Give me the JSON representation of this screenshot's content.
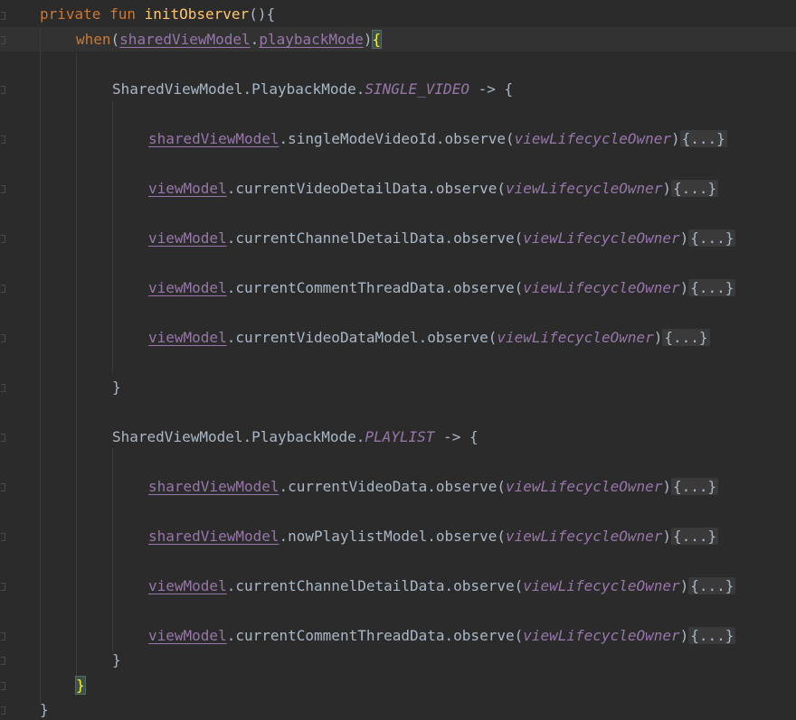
{
  "code": {
    "fun_keywords": "private fun ",
    "fun_name": "initObserver",
    "fun_parens": "(){",
    "when_keyword": "when",
    "paren_open": "(",
    "paren_close": ")",
    "shared_view_model": "sharedViewModel",
    "view_model": "viewModel",
    "dot": ".",
    "playback_mode": "playbackMode",
    "open_brace": "{",
    "close_brace": "}",
    "enum_prefix": "SharedViewModel.PlaybackMode.",
    "arrow": " -> {",
    "mode_single": "SINGLE_VIDEO",
    "mode_playlist": "PLAYLIST",
    "observe_call": ".observe(",
    "owner": "viewLifecycleOwner",
    "folded": "{...}",
    "single_items": [
      {
        "receiver": "sharedViewModel",
        "property": "singleModeVideoId"
      },
      {
        "receiver": "viewModel",
        "property": "currentVideoDetailData"
      },
      {
        "receiver": "viewModel",
        "property": "currentChannelDetailData"
      },
      {
        "receiver": "viewModel",
        "property": "currentCommentThreadData"
      },
      {
        "receiver": "viewModel",
        "property": "currentVideoDataModel"
      }
    ],
    "playlist_items": [
      {
        "receiver": "sharedViewModel",
        "property": "currentVideoData"
      },
      {
        "receiver": "sharedViewModel",
        "property": "nowPlaylistModel"
      },
      {
        "receiver": "viewModel",
        "property": "currentChannelDetailData"
      },
      {
        "receiver": "viewModel",
        "property": "currentCommentThreadData"
      }
    ]
  },
  "colors": {
    "background": "#2b2b2b",
    "keyword": "#cc7832",
    "function": "#ffc66d",
    "property": "#9876aa",
    "plain": "#a9b7c6",
    "brace_highlight": "#ffef28"
  }
}
